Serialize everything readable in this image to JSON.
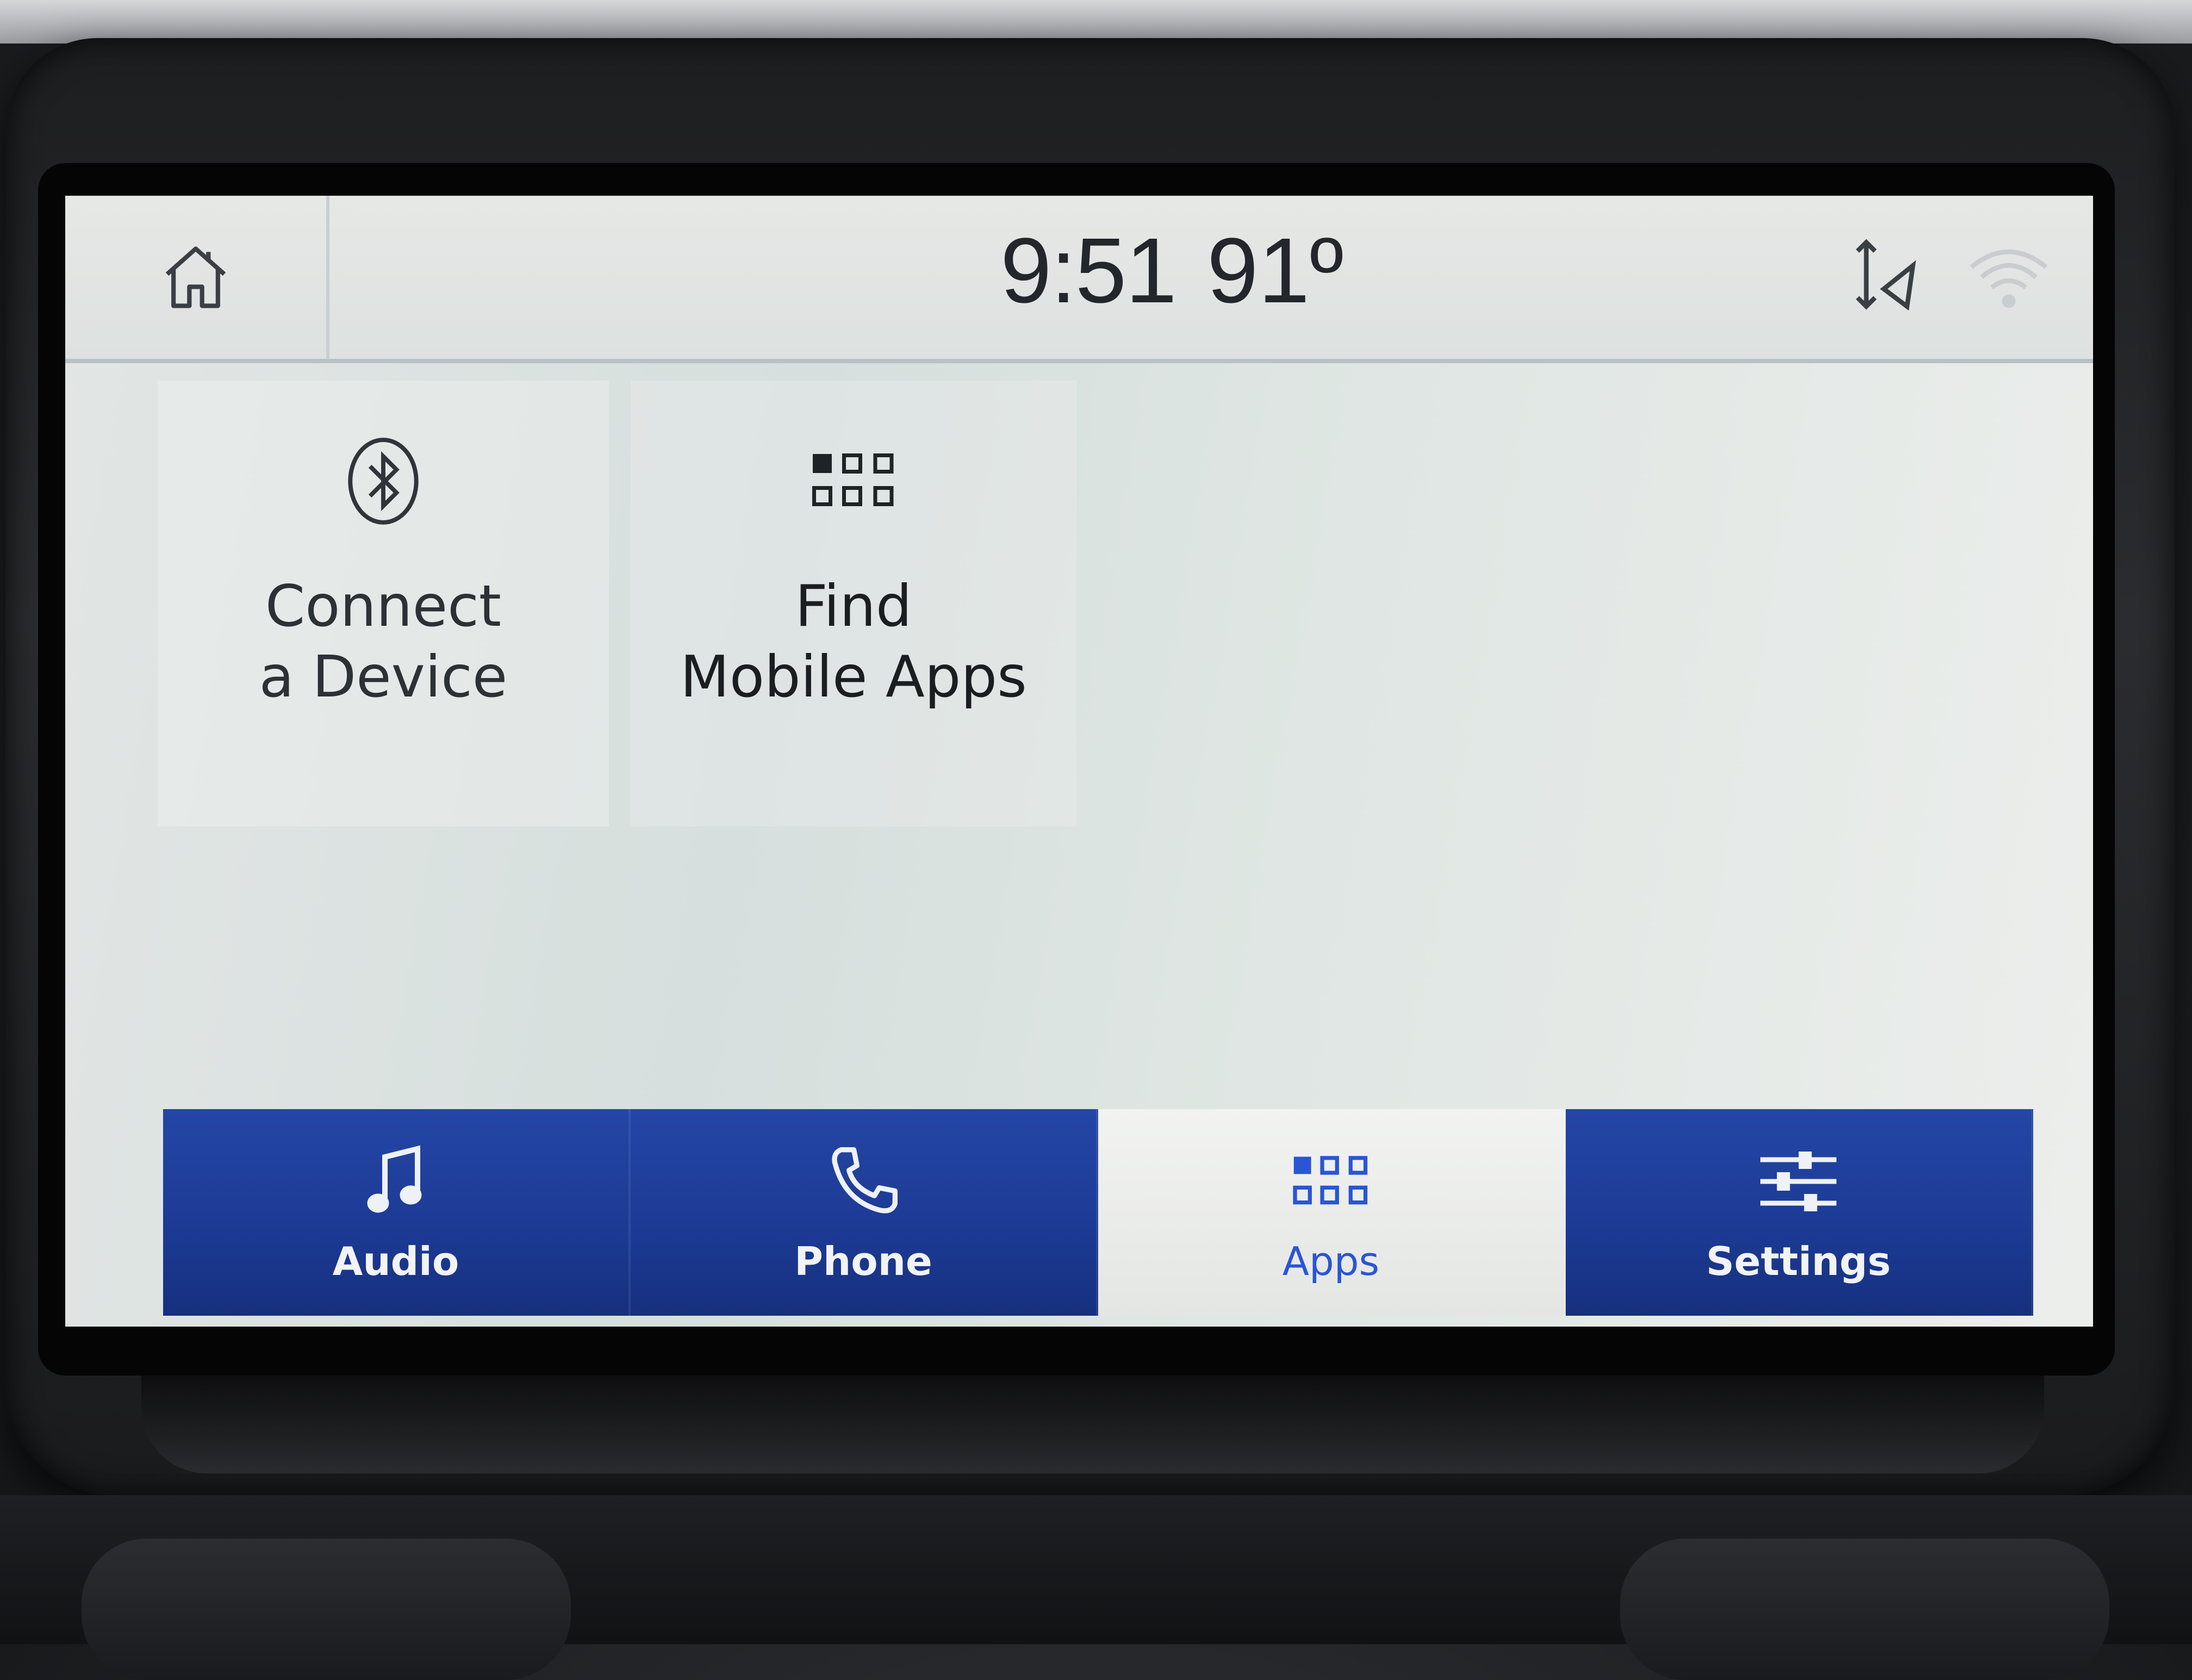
{
  "status_bar": {
    "home_icon": "home-icon",
    "time": "9:51",
    "temperature": "91º",
    "icons": [
      "navigation-arrows-icon",
      "wifi-icon"
    ]
  },
  "tiles": [
    {
      "label_line1": "Connect",
      "label_line2": "a Device",
      "icon": "bluetooth-icon"
    },
    {
      "label_line1": "Find",
      "label_line2": "Mobile Apps",
      "icon": "apps-grid-icon"
    }
  ],
  "nav": {
    "items": [
      {
        "label": "Audio",
        "icon": "music-note-icon",
        "active": false
      },
      {
        "label": "Phone",
        "icon": "phone-icon",
        "active": false
      },
      {
        "label": "Apps",
        "icon": "apps-grid-icon",
        "active": true
      },
      {
        "label": "Settings",
        "icon": "sliders-icon",
        "active": false
      }
    ]
  },
  "colors": {
    "nav_blue": "#1c3a94",
    "active_accent": "#2a55d6",
    "screen_bg": "#dfe6e3",
    "text_dark": "#23272b"
  }
}
